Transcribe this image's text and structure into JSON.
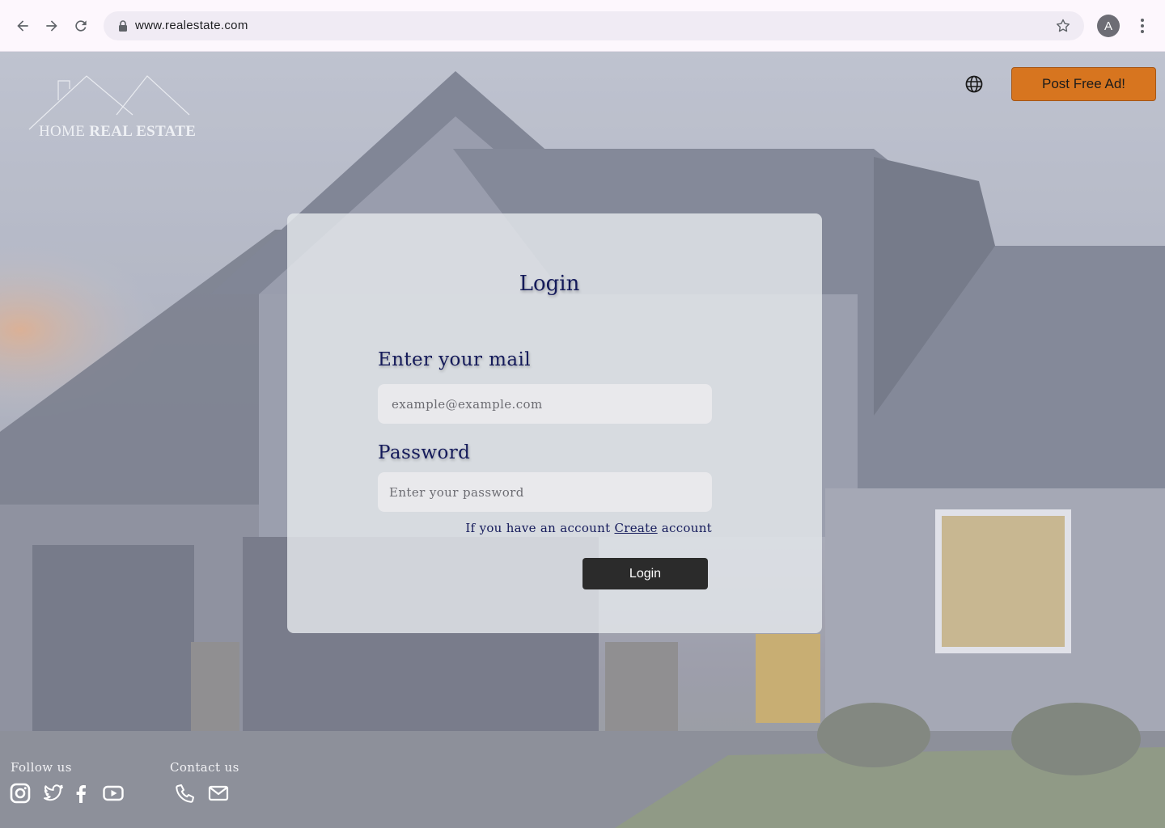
{
  "browser": {
    "url": "www.realestate.com",
    "profile_initial": "A",
    "icons": [
      "back-arrow-icon",
      "forward-arrow-icon",
      "reload-icon",
      "lock-icon",
      "bookmark-star-icon",
      "more-vert-icon"
    ]
  },
  "header": {
    "logo_home": "HOME",
    "logo_real_estate": "REAL ESTATE",
    "post_ad_label": "Post Free Ad!",
    "accent_color": "#d7751f"
  },
  "login": {
    "title": "Login",
    "email_label": "Enter your mail",
    "email_placeholder": "example@example.com",
    "password_label": "Password",
    "password_placeholder": "Enter your password",
    "account_prefix": "If you have an account",
    "create_link": "Create",
    "account_suffix": "account",
    "submit_label": "Login",
    "title_color": "#141a5a"
  },
  "footer": {
    "follow_label": "Follow us",
    "contact_label": "Contact us",
    "social_icons": [
      "instagram-icon",
      "twitter-icon",
      "facebook-icon",
      "youtube-icon"
    ],
    "contact_icons": [
      "phone-icon",
      "mail-icon"
    ]
  }
}
